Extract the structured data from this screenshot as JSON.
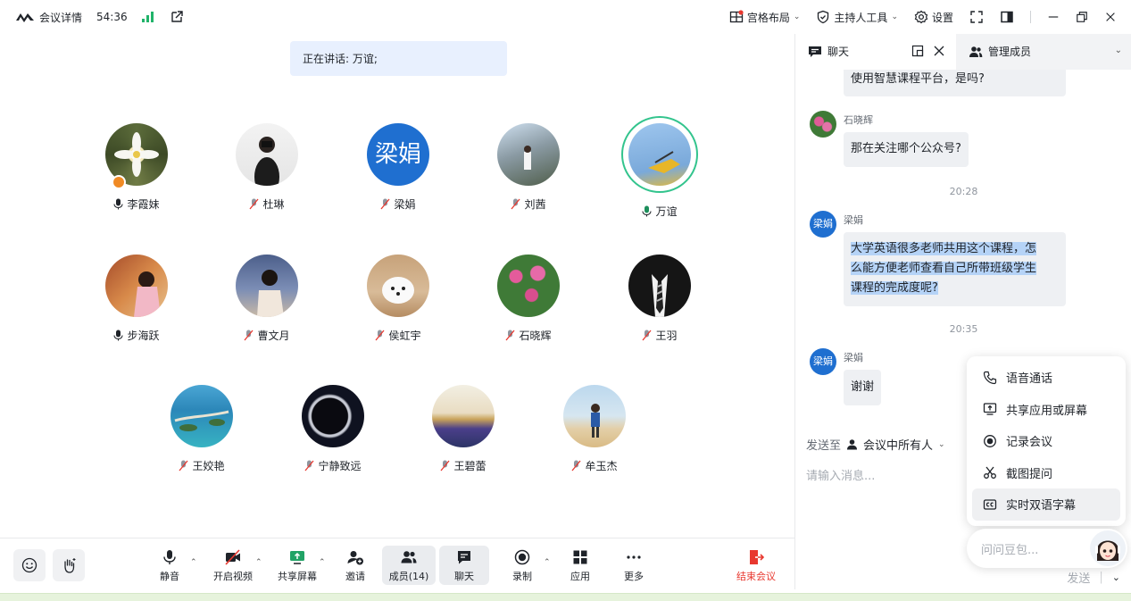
{
  "titlebar": {
    "title": "会议详情",
    "timer": "54:36",
    "layout_label": "宫格布局",
    "host_tools_label": "主持人工具",
    "settings_label": "设置"
  },
  "stage": {
    "speaking": "正在讲话: 万谊;",
    "members": [
      {
        "name": "李霞妹",
        "muted": false,
        "host": true
      },
      {
        "name": "杜琳",
        "muted": true
      },
      {
        "name": "梁娟",
        "muted": true,
        "avatar_text": "梁娟"
      },
      {
        "name": "刘茜",
        "muted": true
      },
      {
        "name": "万谊",
        "muted": false,
        "speaking": true
      },
      {
        "name": "步海跃",
        "muted": false
      },
      {
        "name": "曹文月",
        "muted": true
      },
      {
        "name": "侯虹宇",
        "muted": true
      },
      {
        "name": "石晓辉",
        "muted": true
      },
      {
        "name": "王羽",
        "muted": true
      },
      {
        "name": "王姣艳",
        "muted": true
      },
      {
        "name": "宁静致远",
        "muted": true
      },
      {
        "name": "王碧蕾",
        "muted": true
      },
      {
        "name": "牟玉杰",
        "muted": true
      }
    ]
  },
  "toolbar": {
    "mute": "静音",
    "video": "开启视频",
    "share": "共享屏幕",
    "invite": "邀请",
    "members": "成员(14)",
    "chat": "聊天",
    "record": "录制",
    "apps": "应用",
    "more": "更多",
    "end": "结束会议"
  },
  "panel": {
    "chat_tab": "聊天",
    "members_tab": "管理成员",
    "messages": [
      {
        "text": "使用智慧课程平台，是吗?"
      },
      {
        "sender": "石晓辉",
        "text": "那在关注哪个公众号?"
      },
      {
        "time": "20:28"
      },
      {
        "sender": "梁娟",
        "avatar_text": "梁娟",
        "lines": [
          "大学英语很多老师共用这个课程，怎",
          "么能方便老师查看自己所带班级学生",
          "课程的完成度呢?"
        ]
      },
      {
        "time": "20:35"
      },
      {
        "sender": "梁娟",
        "avatar_text": "梁娟",
        "text": "谢谢"
      }
    ],
    "send_to_label": "发送至",
    "send_to_value": "会议中所有人",
    "input_placeholder": "请输入消息...",
    "send_button": "发送"
  },
  "popup": {
    "items": [
      "语音通话",
      "共享应用或屏幕",
      "记录会议",
      "截图提问",
      "实时双语字幕"
    ],
    "ask_placeholder": "问问豆包..."
  },
  "colors": {
    "accent_blue": "#1f6fd0",
    "speaking_green": "#33c48d",
    "end_red": "#e8382f",
    "signal_green": "#21b36a"
  }
}
